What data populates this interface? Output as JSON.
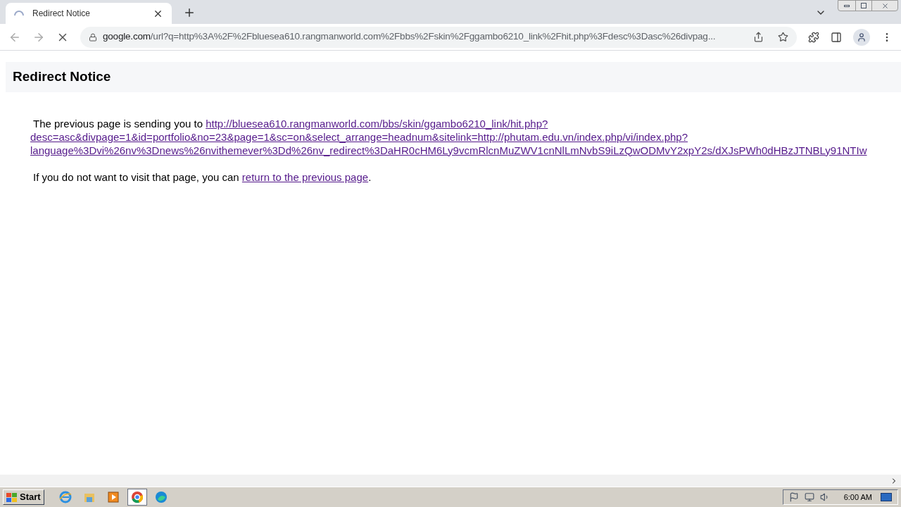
{
  "tabs": [
    {
      "title": "Redirect Notice",
      "loading": true,
      "selected": true
    }
  ],
  "address_bar": {
    "domain": "google.com",
    "path": "/url?q=http%3A%2F%2Fbluesea610.rangmanworld.com%2Fbbs%2Fskin%2Fggambo6210_link%2Fhit.php%3Fdesc%3Dasc%26divpag..."
  },
  "page": {
    "heading": "Redirect Notice",
    "intro": "The previous page is sending you to",
    "link_lines": [
      "http://bluesea610.rangmanworld.com/bbs/skin/ggambo6210_link/hit.php?",
      "desc=asc&divpage=1&id=portfolio&no=23&page=1&sc=on&select_arrange=headnum&sitelink=http://phutam.edu.vn/index.php/vi/index.php?",
      "language%3Dvi%26nv%3Dnews%26nvithemever%3Dd%26nv_redirect%3DaHR0cHM6Ly9vcmRlcnMuZWV1cnNlLmNvbS9iLzQwODMvY2xpY2s/dXJsPWh0dHBzJTNBLy91NTIw"
    ],
    "decline_text": "If you do not want to visit that page, you can",
    "decline_link": "return to the previous page",
    "decline_end": "."
  },
  "taskbar": {
    "start": "Start",
    "apps": [
      {
        "kind": "ie",
        "selected": false
      },
      {
        "kind": "folder",
        "selected": false
      },
      {
        "kind": "media",
        "selected": false
      },
      {
        "kind": "chrome",
        "selected": true
      },
      {
        "kind": "edge",
        "selected": false
      }
    ],
    "clock": "6:00 AM"
  }
}
